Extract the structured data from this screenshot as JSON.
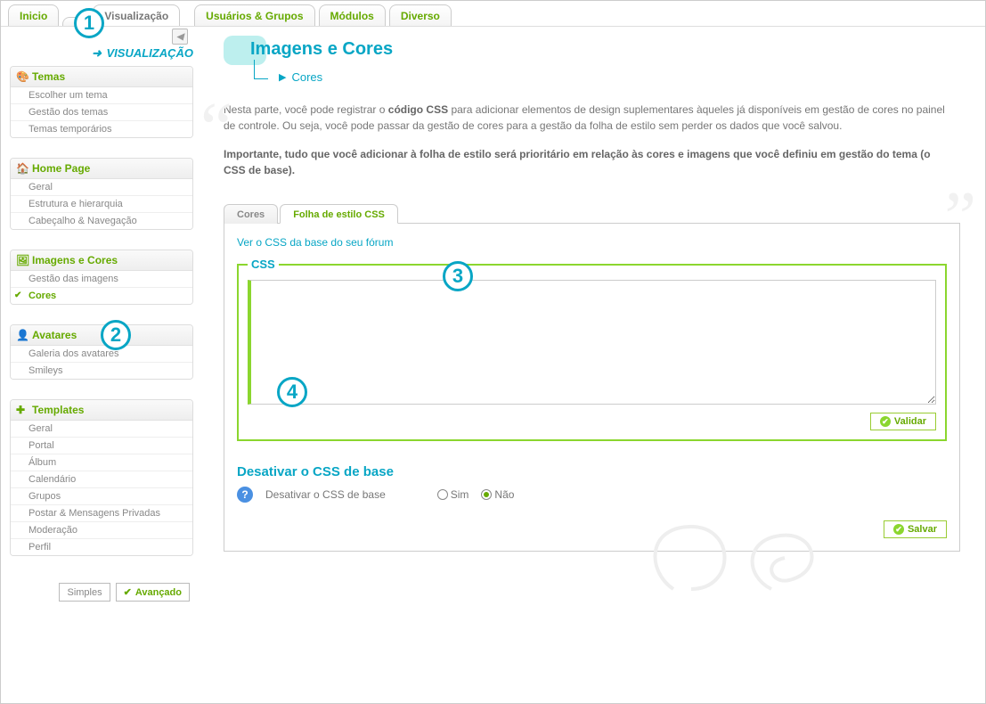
{
  "topTabs": {
    "inicio": "Inicio",
    "hidden": "",
    "visualizacao": "Visualização",
    "usuarios": "Usuários & Grupos",
    "modulos": "Módulos",
    "diverso": "Diverso"
  },
  "breadcrumbLabel": "VISUALIZAÇÃO",
  "sidebar": {
    "temas": {
      "title": "Temas",
      "items": [
        "Escolher um tema",
        "Gestão dos temas",
        "Temas temporários"
      ]
    },
    "homepage": {
      "title": "Home Page",
      "items": [
        "Geral",
        "Estrutura e hierarquia",
        "Cabeçalho & Navegação"
      ]
    },
    "imagens": {
      "title": "Imagens e Cores",
      "items": [
        "Gestão das imagens",
        "Cores"
      ]
    },
    "avatares": {
      "title": "Avatares",
      "items": [
        "Galeria dos avatares",
        "Smileys"
      ]
    },
    "templates": {
      "title": "Templates",
      "items": [
        "Geral",
        "Portal",
        "Álbum",
        "Calendário",
        "Grupos",
        "Postar & Mensagens Privadas",
        "Moderação",
        "Perfil"
      ]
    }
  },
  "modeSimple": "Simples",
  "modeAdvanced": "Avançado",
  "pageTitle": "Imagens e Cores",
  "crumbSub": "Cores",
  "intro": {
    "p1a": "Nesta parte, você pode registrar o ",
    "p1b": "código CSS",
    "p1c": " para adicionar elementos de design suplementares àqueles já disponíveis em gestão de cores no painel de controle. Ou seja, você pode passar da gestão de cores para a gestão da folha de estilo sem perder os dados que você salvou.",
    "p2": "Importante, tudo que você adicionar à folha de estilo será prioritário em relação às cores e imagens que você definiu em gestão do tema (o CSS de base)."
  },
  "subtabs": {
    "cores": "Cores",
    "folha": "Folha de estilo CSS"
  },
  "viewBaseLink": "Ver o CSS da base do seu fórum",
  "cssLegend": "CSS",
  "validateBtn": "Validar",
  "deactivate": {
    "title": "Desativar o CSS de base",
    "label": "Desativar o CSS de base",
    "yes": "Sim",
    "no": "Não"
  },
  "saveBtn": "Salvar",
  "badges": {
    "b1": "1",
    "b2": "2",
    "b3": "3",
    "b4": "4"
  }
}
